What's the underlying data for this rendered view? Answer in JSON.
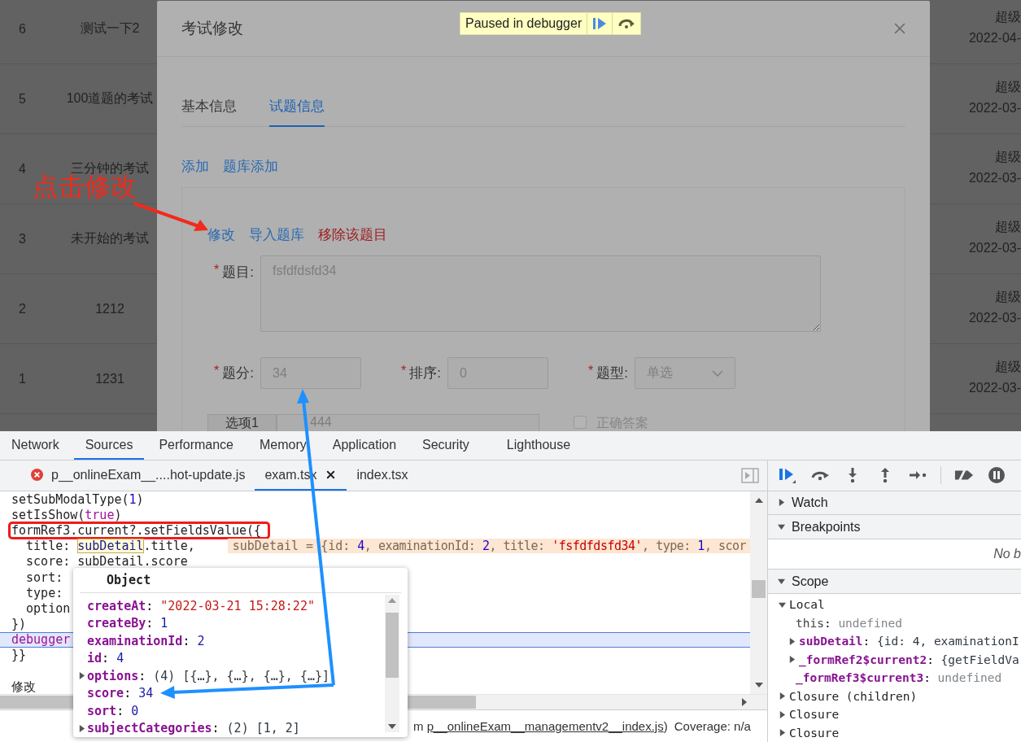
{
  "background_table": {
    "rows": [
      {
        "index": "6",
        "name": "测试一下2",
        "column_3": "超级",
        "column_4": "2022-04-"
      },
      {
        "index": "5",
        "name": "100道题的考试",
        "column_3": "超级",
        "column_4": "2022-03-"
      },
      {
        "index": "4",
        "name": "三分钟的考试",
        "column_3": "超级",
        "column_4": "2022-03-"
      },
      {
        "index": "3",
        "name": "未开始的考试",
        "column_3": "超级",
        "column_4": "2022-03-"
      },
      {
        "index": "2",
        "name": "1212",
        "column_3": "超级",
        "column_4": "2022-03-"
      },
      {
        "index": "1",
        "name": "1231",
        "column_3": "超级",
        "column_4": "2022-03-"
      }
    ]
  },
  "modal": {
    "title": "考试修改",
    "tabs": [
      {
        "label": "基本信息",
        "selected": false
      },
      {
        "label": "试题信息",
        "selected": true
      }
    ],
    "links": [
      "添加",
      "题库添加"
    ],
    "question": {
      "actions": [
        {
          "label": "修改",
          "kind": "link"
        },
        {
          "label": "导入题库",
          "kind": "link"
        },
        {
          "label": "移除该题目",
          "kind": "danger"
        }
      ],
      "title_field": {
        "label": "题目:",
        "required_mark": "*",
        "value": "fsfdfdsfd34"
      },
      "fields": [
        {
          "label": "题分:",
          "required_mark": "*",
          "value": "34",
          "kind": "input"
        },
        {
          "label": "排序:",
          "required_mark": "*",
          "value": "0",
          "kind": "input"
        },
        {
          "label": "题型:",
          "required_mark": "*",
          "value": "单选",
          "kind": "select"
        }
      ],
      "option": {
        "addon": "选项1",
        "value": "444",
        "checkbox_label": "正确答案",
        "checked": false
      }
    }
  },
  "debugger_banner": {
    "label": "Paused in debugger"
  },
  "annotation": {
    "label": "点击修改"
  },
  "devtools": {
    "tabs": [
      {
        "label": "Network",
        "selected": false
      },
      {
        "label": "Sources",
        "selected": true
      },
      {
        "label": "Performance",
        "selected": false
      },
      {
        "label": "Memory",
        "selected": false
      },
      {
        "label": "Application",
        "selected": false
      },
      {
        "label": "Security",
        "selected": false
      },
      {
        "label": "Lighthouse",
        "selected": false
      }
    ],
    "files": [
      {
        "name": "p__onlineExam__....hot-update.js",
        "selected": false,
        "error": true
      },
      {
        "name": "exam.tsx",
        "selected": true,
        "error": false
      },
      {
        "name": "index.tsx",
        "selected": false,
        "error": false
      }
    ],
    "code_lines": [
      {
        "kind": "code",
        "segments": [
          {
            "text": "setSubModalType(",
            "kind": "plain"
          },
          {
            "text": "1",
            "kind": "number"
          },
          {
            "text": ")",
            "kind": "plain"
          }
        ]
      },
      {
        "kind": "code",
        "segments": [
          {
            "text": "setIsShow(",
            "kind": "plain"
          },
          {
            "text": "true",
            "kind": "keyword"
          },
          {
            "text": ")",
            "kind": "plain"
          }
        ]
      },
      {
        "kind": "code",
        "boxed": true,
        "segments": [
          {
            "text": "formRef3.current?.setFieldsValue({",
            "kind": "plain"
          }
        ]
      },
      {
        "kind": "code",
        "segments": [
          {
            "text": "  title: ",
            "kind": "plain"
          },
          {
            "text": "subDetail",
            "kind": "hover"
          },
          {
            "text": ".title,",
            "kind": "plain"
          }
        ],
        "inline_value": [
          {
            "text": "subDetail = {id: ",
            "kind": "muted"
          },
          {
            "text": "4",
            "kind": "number"
          },
          {
            "text": ", examinationId: ",
            "kind": "muted"
          },
          {
            "text": "2",
            "kind": "number"
          },
          {
            "text": ", title: ",
            "kind": "muted"
          },
          {
            "text": "'fsfdfdsfd34'",
            "kind": "string"
          },
          {
            "text": ", type: ",
            "kind": "muted"
          },
          {
            "text": "1",
            "kind": "number"
          },
          {
            "text": ", scor",
            "kind": "muted"
          }
        ]
      },
      {
        "kind": "code",
        "segments": [
          {
            "text": "  score: subDetail.score",
            "kind": "plain"
          }
        ]
      },
      {
        "kind": "code",
        "segments": [
          {
            "text": "  sort:",
            "kind": "plain"
          }
        ]
      },
      {
        "kind": "code",
        "segments": [
          {
            "text": "  type:",
            "kind": "plain"
          }
        ]
      },
      {
        "kind": "code",
        "segments": [
          {
            "text": "  option",
            "kind": "plain"
          }
        ]
      },
      {
        "kind": "code",
        "segments": [
          {
            "text": "})",
            "kind": "plain"
          }
        ]
      },
      {
        "kind": "code",
        "paused": true,
        "segments": [
          {
            "text": "debugger",
            "kind": "keyword"
          }
        ]
      },
      {
        "kind": "code",
        "segments": [
          {
            "text": "}}",
            "kind": "plain"
          }
        ]
      },
      {
        "kind": "blank"
      },
      {
        "kind": "code",
        "segments": [
          {
            "text": "修改",
            "kind": "plain"
          }
        ]
      }
    ],
    "popover": {
      "title": "Object",
      "separator": ": ",
      "entries": [
        {
          "key": "createAt",
          "value": "\"2022-03-21 15:28:22\"",
          "kind": "string"
        },
        {
          "key": "createBy",
          "value": "1",
          "kind": "number"
        },
        {
          "key": "examinationId",
          "value": "2",
          "kind": "number"
        },
        {
          "key": "id",
          "value": "4",
          "kind": "number"
        },
        {
          "key": "options",
          "value": "(4) [{…}, {…}, {…}, {…}]",
          "kind": "array",
          "expanded": false
        },
        {
          "key": "score",
          "value": "34",
          "kind": "number"
        },
        {
          "key": "sort",
          "value": "0",
          "kind": "number"
        },
        {
          "key": "subjectCategories",
          "value": "(2) [1, 2]",
          "kind": "array",
          "expanded": false
        }
      ]
    },
    "status_bar": {
      "prefix": "m ",
      "link": "p__onlineExam__managementv2__index.js",
      "suffix": ")",
      "coverage": "Coverage: n/a"
    },
    "sidebar": {
      "sections": [
        {
          "label": "Watch",
          "expanded": false
        },
        {
          "label": "Breakpoints",
          "expanded": true,
          "message": "No b"
        },
        {
          "label": "Scope",
          "expanded": true
        }
      ],
      "separator": ": ",
      "scope_tree": [
        {
          "name": "Local",
          "kind": "group",
          "expanded": true,
          "children": [
            {
              "name": "this",
              "kind": "internal",
              "value": {
                "text": "undefined",
                "kind": "undefined"
              }
            },
            {
              "name": "subDetail",
              "kind": "own",
              "expanded": false,
              "value": {
                "text": "{id: 4, examinationI",
                "kind": "object"
              }
            },
            {
              "name": "_formRef2$current2",
              "kind": "own",
              "expanded": false,
              "value": {
                "text": "{getFieldVa",
                "kind": "object"
              }
            },
            {
              "name": "_formRef3$current3",
              "kind": "own",
              "value": {
                "text": "undefined",
                "kind": "undefined"
              }
            }
          ]
        },
        {
          "name": "Closure (children)",
          "kind": "group",
          "expanded": false
        },
        {
          "name": "Closure",
          "kind": "group",
          "expanded": false
        },
        {
          "name": "Closure",
          "kind": "group",
          "expanded": false
        }
      ]
    }
  }
}
